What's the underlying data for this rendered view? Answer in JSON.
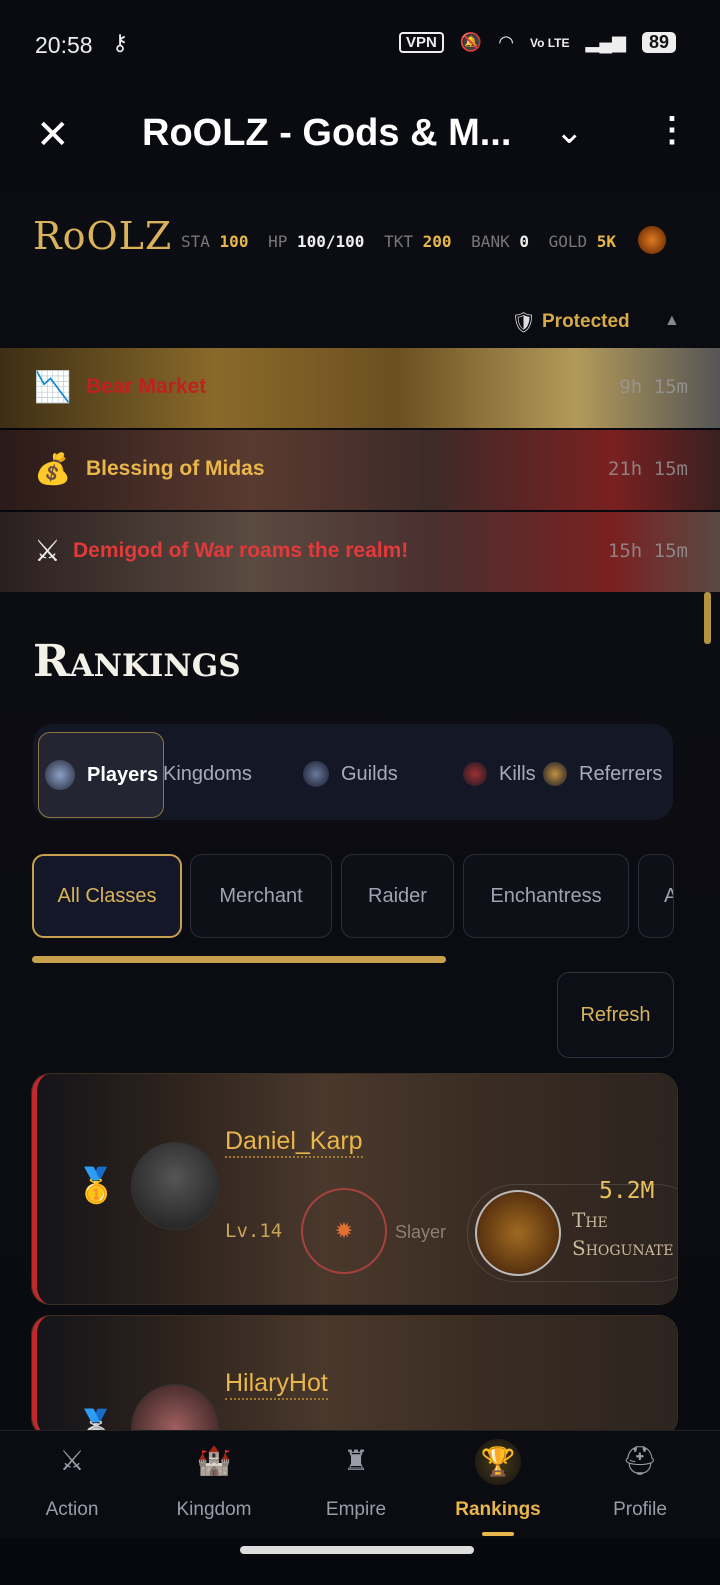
{
  "status": {
    "time": "20:58",
    "vpn": "VPN",
    "network": "Vo LTE",
    "battery": "89"
  },
  "browser": {
    "title": "RoOLZ - Gods & M..."
  },
  "game": {
    "logo": "RoOLZ",
    "stats": [
      {
        "label": "STA",
        "value": "100"
      },
      {
        "label": "HP",
        "value": "100/100"
      },
      {
        "label": "TKT",
        "value": "200"
      },
      {
        "label": "BANK",
        "value": "0"
      },
      {
        "label": "GOLD",
        "value": "5K"
      }
    ],
    "protected": "Protected"
  },
  "events": [
    {
      "icon": "📉",
      "label": "Bear Market",
      "timer": "9h 15m",
      "color": "#c02020"
    },
    {
      "icon": "💰",
      "label": "Blessing of Midas",
      "timer": "21h 15m",
      "color": "#e8b64a"
    },
    {
      "icon": "⚔",
      "label": "Demigod of War roams the realm!",
      "timer": "15h 15m",
      "color": "#e03a3a"
    }
  ],
  "rankings": {
    "title": "Rankings",
    "tabs": [
      {
        "label": "Players",
        "active": true
      },
      {
        "label": "Kingdoms"
      },
      {
        "label": "Guilds"
      },
      {
        "label": "Kills"
      },
      {
        "label": "Referrers"
      }
    ],
    "classes": [
      "All Classes",
      "Merchant",
      "Raider",
      "Enchantress",
      "A"
    ],
    "refresh": "Refresh",
    "players": [
      {
        "rank_icon": "🥇",
        "name": "Daniel_Karp",
        "level": "Lv.14",
        "class": "Slayer",
        "score": "5.2M",
        "guild": "The Shogunate"
      },
      {
        "rank_icon": "🥈",
        "name": "HilaryHot",
        "level": "",
        "class": "",
        "score": "",
        "guild": ""
      }
    ]
  },
  "nav": [
    {
      "icon": "⚔",
      "label": "Action"
    },
    {
      "icon": "🏰",
      "label": "Kingdom"
    },
    {
      "icon": "♜",
      "label": "Empire"
    },
    {
      "icon": "🏆",
      "label": "Rankings",
      "active": true
    },
    {
      "icon": "⛑",
      "label": "Profile"
    }
  ]
}
